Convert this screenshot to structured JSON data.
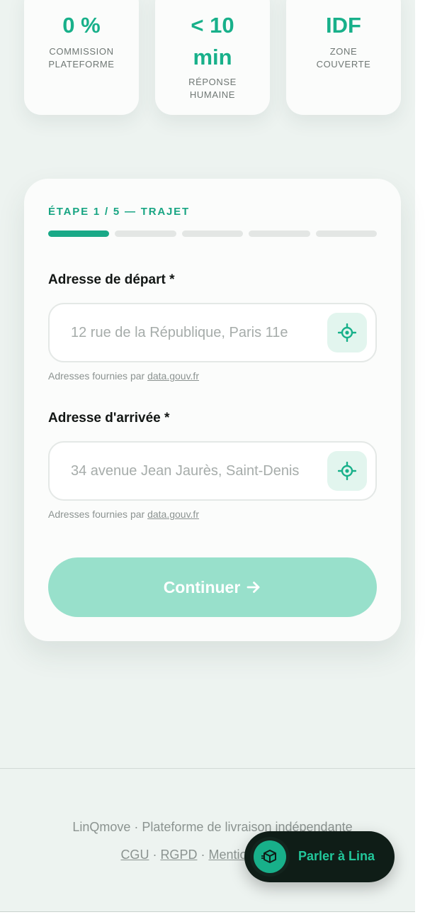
{
  "stats": [
    {
      "value": "0 %",
      "label": "COMMISSION PLATEFORME"
    },
    {
      "value": "< 10 min",
      "label": "RÉPONSE HUMAINE"
    },
    {
      "value": "IDF",
      "label": "ZONE COUVERTE"
    }
  ],
  "form": {
    "step_label": "ÉTAPE 1 / 5 — TRAJET",
    "progress": {
      "current_step": 1,
      "total_steps": 5
    },
    "departure": {
      "label": "Adresse de départ *",
      "placeholder": "12 rue de la République, Paris 11e",
      "value": "",
      "hint_prefix": "Adresses fournies par",
      "hint_link": "data.gouv.fr",
      "locate_icon": "crosshair-icon"
    },
    "arrival": {
      "label": "Adresse d'arrivée *",
      "placeholder": "34 avenue Jean Jaurès, Saint-Denis",
      "value": "",
      "hint_prefix": "Adresses fournies par",
      "hint_link": "data.gouv.fr",
      "locate_icon": "crosshair-icon"
    },
    "continue_label": "Continuer",
    "continue_icon": "arrow-right-icon"
  },
  "footer": {
    "tagline": "LinQmove · Plateforme de livraison indépendante",
    "links": [
      "CGU",
      "RGPD",
      "Mentions légales"
    ]
  },
  "chat": {
    "label": "Parler à Lina",
    "icon": "package-icon"
  },
  "colors": {
    "accent": "#18b08a",
    "accent_light": "#98e0cb",
    "background": "#edf3f0",
    "chat_bg": "#0f1d17"
  }
}
